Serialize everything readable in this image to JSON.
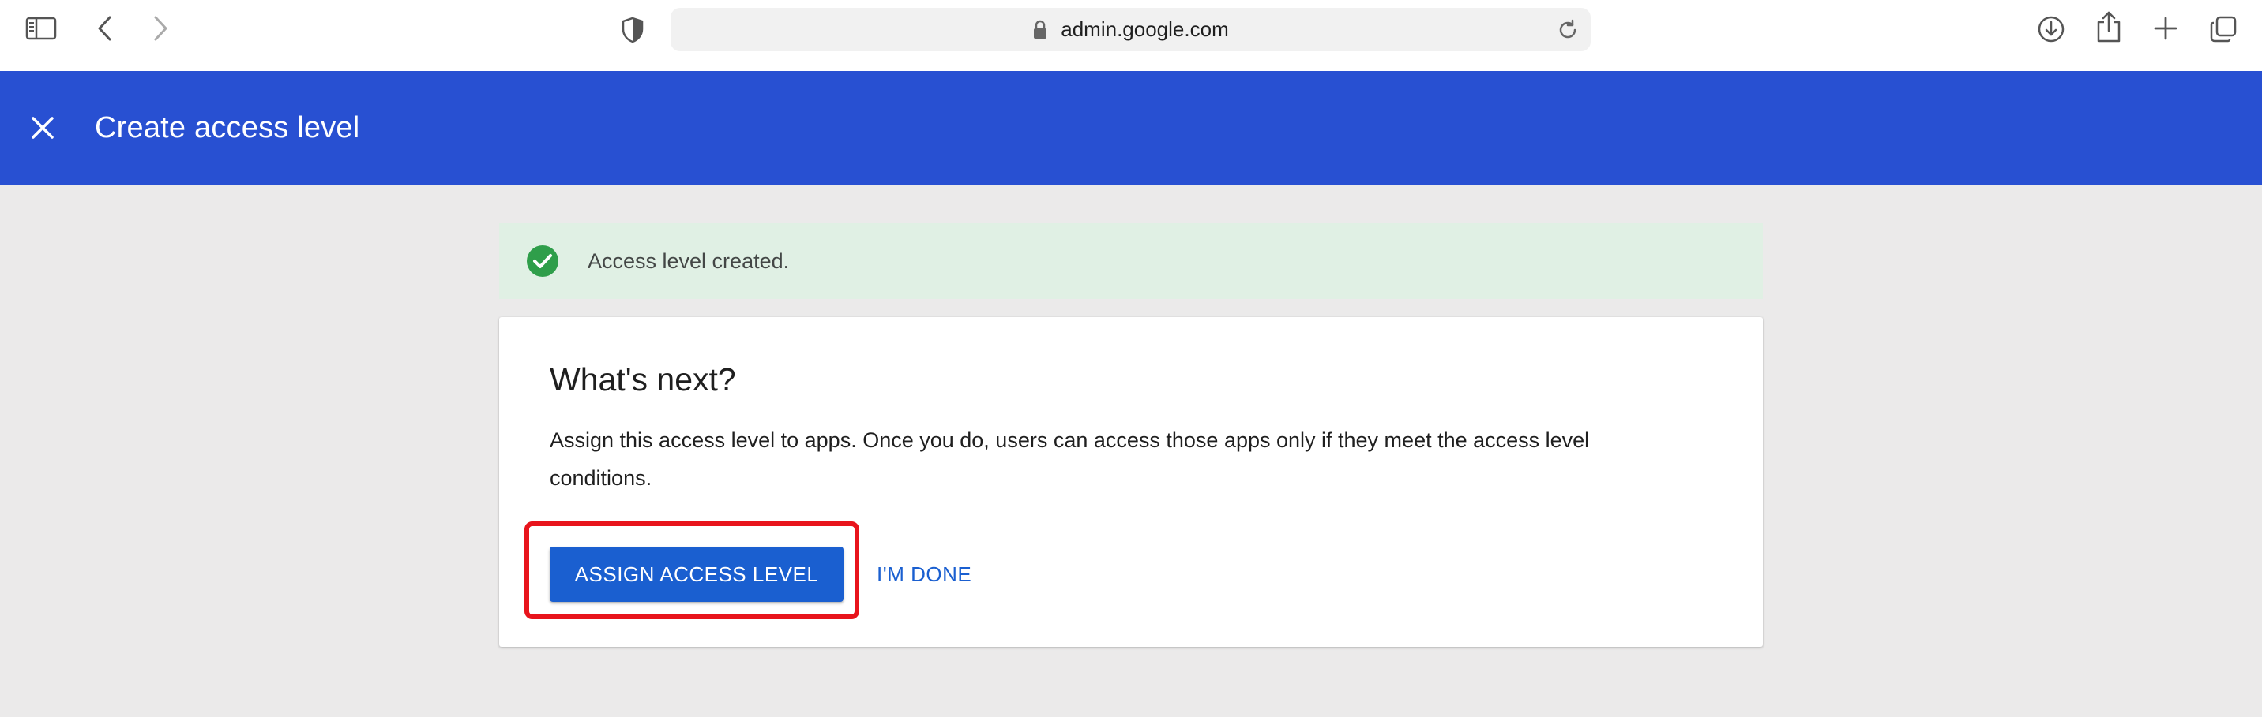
{
  "browser": {
    "url": "admin.google.com",
    "icons": {
      "sidebar": "sidebar-icon",
      "back": "chevron-left-icon",
      "forward": "chevron-right-icon",
      "privacy": "shield-icon",
      "lock": "lock-icon",
      "reload": "reload-icon",
      "download": "download-icon",
      "share": "share-icon",
      "new_tab": "plus-icon",
      "tabs": "tabs-overview-icon"
    }
  },
  "header": {
    "title": "Create access level",
    "close_icon": "close-icon",
    "background": "#2850d2"
  },
  "banner": {
    "message": "Access level created.",
    "icon": "check-circle-icon",
    "icon_color": "#2f9e4a",
    "background": "#e0f0e4"
  },
  "card": {
    "title": "What's next?",
    "body": "Assign this access level to apps. Once you do, users can access those apps only if they meet the access level conditions.",
    "primary_button": "ASSIGN ACCESS LEVEL",
    "secondary_button": "I'M DONE",
    "accent": "#1a5fd0",
    "highlight_color": "#e8141c"
  }
}
